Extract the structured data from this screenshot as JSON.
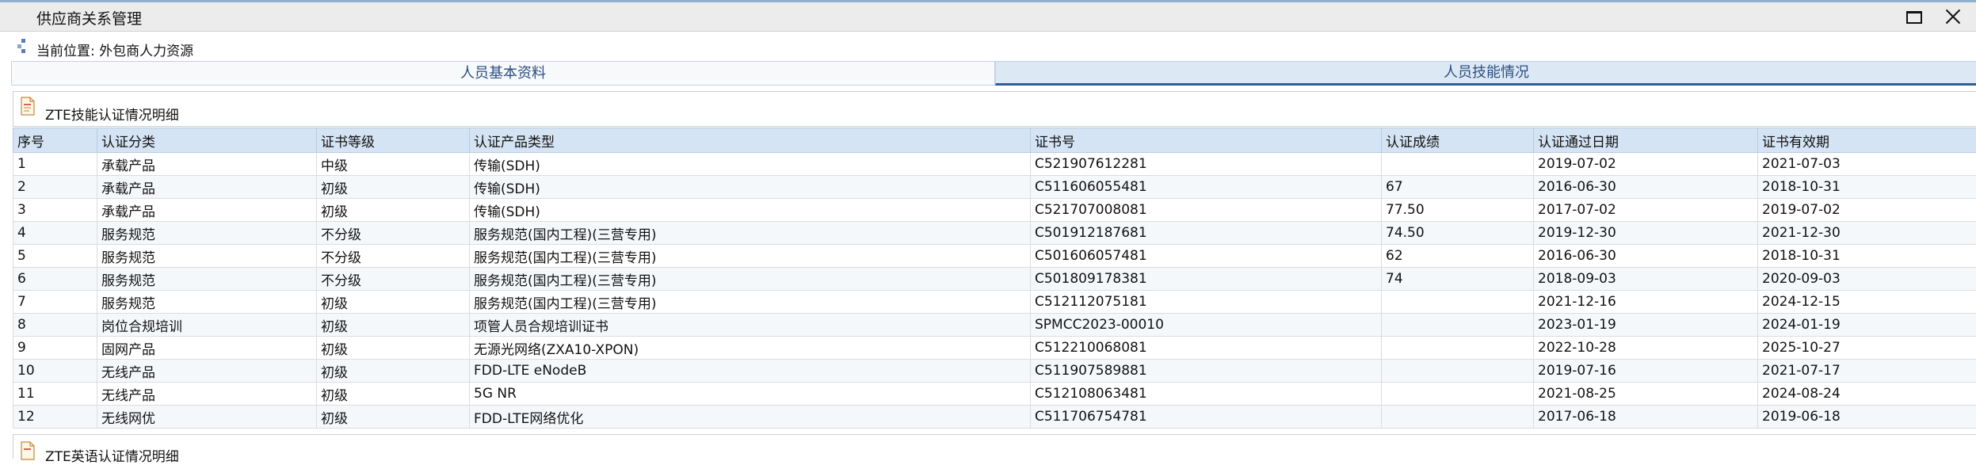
{
  "window": {
    "title": "供应商关系管理"
  },
  "location": {
    "label": "当前位置:",
    "path": "外包商人力资源"
  },
  "tabs": [
    {
      "label": "人员基本资料",
      "selected": false
    },
    {
      "label": "人员技能情况",
      "selected": true
    }
  ],
  "section1": {
    "title": "ZTE技能认证情况明细",
    "columns": [
      "序号",
      "认证分类",
      "证书等级",
      "认证产品类型",
      "证书号",
      "认证成绩",
      "认证通过日期",
      "证书有效期"
    ],
    "rows": [
      [
        "1",
        "承载产品",
        "中级",
        "传输(SDH)",
        "C521907612281",
        "",
        "2019-07-02",
        "2021-07-03"
      ],
      [
        "2",
        "承载产品",
        "初级",
        "传输(SDH)",
        "C511606055481",
        "67",
        "2016-06-30",
        "2018-10-31"
      ],
      [
        "3",
        "承载产品",
        "初级",
        "传输(SDH)",
        "C521707008081",
        "77.50",
        "2017-07-02",
        "2019-07-02"
      ],
      [
        "4",
        "服务规范",
        "不分级",
        "服务规范(国内工程)(三营专用)",
        "C501912187681",
        "74.50",
        "2019-12-30",
        "2021-12-30"
      ],
      [
        "5",
        "服务规范",
        "不分级",
        "服务规范(国内工程)(三营专用)",
        "C501606057481",
        "62",
        "2016-06-30",
        "2018-10-31"
      ],
      [
        "6",
        "服务规范",
        "不分级",
        "服务规范(国内工程)(三营专用)",
        "C501809178381",
        "74",
        "2018-09-03",
        "2020-09-03"
      ],
      [
        "7",
        "服务规范",
        "初级",
        "服务规范(国内工程)(三营专用)",
        "C512112075181",
        "",
        "2021-12-16",
        "2024-12-15"
      ],
      [
        "8",
        "岗位合规培训",
        "初级",
        "项管人员合规培训证书",
        "SPMCC2023-00010",
        "",
        "2023-01-19",
        "2024-01-19"
      ],
      [
        "9",
        "固网产品",
        "初级",
        "无源光网络(ZXA10-XPON)",
        "C512210068081",
        "",
        "2022-10-28",
        "2025-10-27"
      ],
      [
        "10",
        "无线产品",
        "初级",
        "FDD-LTE eNodeB",
        "C511907589881",
        "",
        "2019-07-16",
        "2021-07-17"
      ],
      [
        "11",
        "无线产品",
        "初级",
        "5G NR",
        "C512108063481",
        "",
        "2021-08-25",
        "2024-08-24"
      ],
      [
        "12",
        "无线网优",
        "初级",
        "FDD-LTE网络优化",
        "C511706754781",
        "",
        "2017-06-18",
        "2019-06-18"
      ]
    ]
  },
  "section2": {
    "title": "ZTE英语认证情况明细"
  }
}
